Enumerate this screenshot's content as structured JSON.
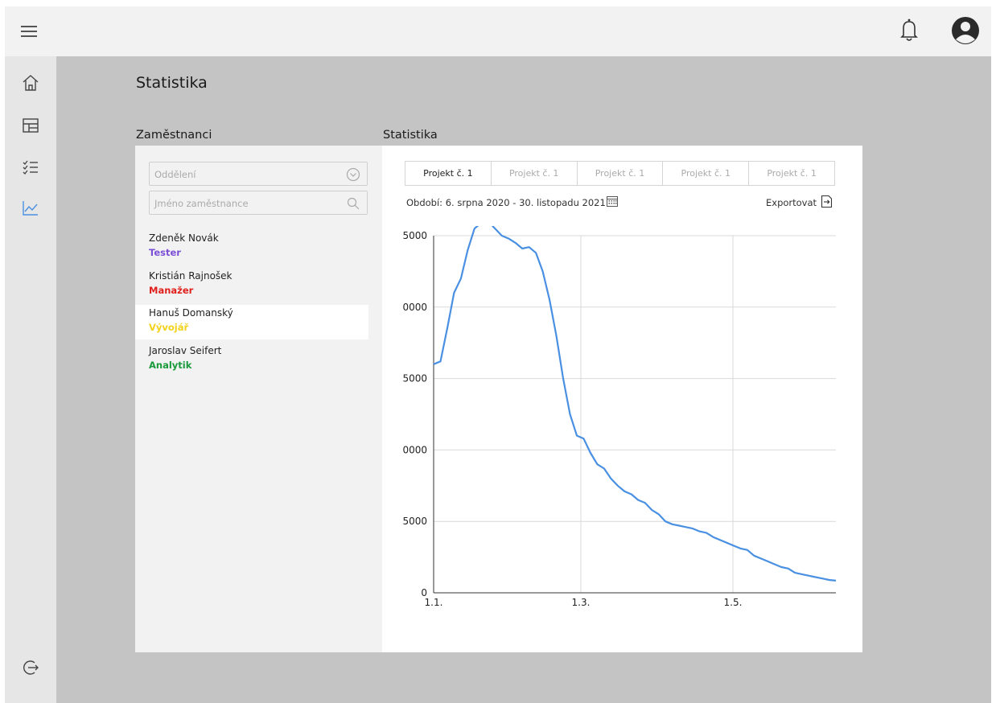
{
  "icons": {
    "menu": "menu-icon",
    "bell": "bell-icon",
    "user": "user-avatar-icon",
    "home": "home-icon",
    "dashboard": "dashboard-icon",
    "tasks": "checklist-icon",
    "stats": "line-chart-icon",
    "logout": "logout-icon",
    "dropdown": "chevron-down-circle-icon",
    "search": "search-icon",
    "calendar": "calendar-icon",
    "export": "export-file-icon"
  },
  "colors": {
    "accent": "#4a90e2",
    "role_tester": "#7b4fd6",
    "role_manager": "#e0201c",
    "role_developer": "#f2d21b",
    "role_analyst": "#1a9a3c"
  },
  "page": {
    "title": "Statistika"
  },
  "employees": {
    "section_title": "Zaměstnanci",
    "department_placeholder": "Oddělení",
    "name_placeholder": "Jméno zaměstnance",
    "list": [
      {
        "name": "Zdeněk Novák",
        "role": "Tester"
      },
      {
        "name": "Kristián Rajnošek",
        "role": "Manažer"
      },
      {
        "name": "Hanuš Domanský",
        "role": "Vývojář"
      },
      {
        "name": "Jaroslav Seifert",
        "role": "Analytik"
      }
    ],
    "selected_index": 2
  },
  "stats": {
    "section_title": "Statistika",
    "tabs": [
      "Projekt č. 1",
      "Projekt č. 1",
      "Projekt č. 1",
      "Projekt č. 1",
      "Projekt č. 1"
    ],
    "active_tab": 0,
    "period": "Období: 6. srpna 2020 - 30. listopadu 2021",
    "export_label": "Exportovat"
  },
  "chart_data": {
    "type": "line",
    "y_tick_labels": [
      "0",
      "5000",
      "0000",
      "5000",
      "0000",
      "5000"
    ],
    "x_tick_labels": [
      "1.1.",
      "1.3.",
      "1.5."
    ],
    "ylim": [
      0,
      25000
    ],
    "grid": true,
    "legend": "none",
    "series": [
      {
        "values": [
          16000,
          16200,
          18500,
          21000,
          22000,
          24000,
          25500,
          25900,
          26000,
          25500,
          25000,
          24800,
          24500,
          24100,
          24200,
          23800,
          22500,
          20500,
          18000,
          15000,
          12500,
          11000,
          10800,
          9800,
          9000,
          8700,
          8000,
          7500,
          7100,
          6900,
          6500,
          6300,
          5800,
          5500,
          5000,
          4800,
          4700,
          4600,
          4500,
          4300,
          4200,
          3900,
          3700,
          3500,
          3300,
          3100,
          3000,
          2600,
          2400,
          2200,
          2000,
          1800,
          1700,
          1400,
          1300,
          1200,
          1100,
          1000,
          900,
          850
        ]
      }
    ]
  }
}
